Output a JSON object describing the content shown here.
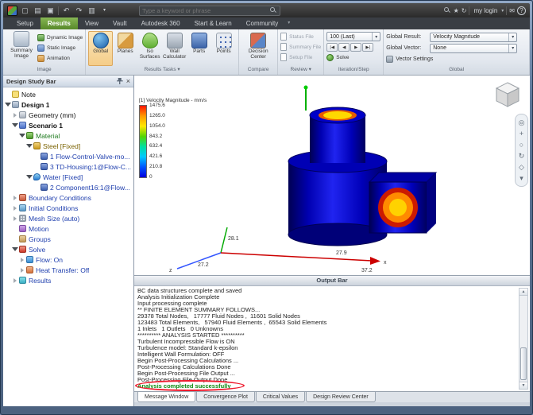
{
  "titlebar": {
    "search_placeholder": "Type a keyword or phrase",
    "login_label": "my login"
  },
  "ribbon_tabs": {
    "items": [
      "Setup",
      "Results",
      "View",
      "Vault",
      "Autodesk 360",
      "Start & Learn",
      "Community"
    ],
    "active": "Results"
  },
  "ribbon": {
    "image": {
      "label": "Image",
      "summary": "Summary Image",
      "dynamic": "Dynamic Image",
      "static": "Static Image",
      "animation": "Animation"
    },
    "results_tasks": {
      "label": "Results Tasks ▾",
      "global": "Global",
      "planes": "Planes",
      "iso": "Iso Surfaces",
      "wall": "Wall Calculator",
      "parts": "Parts",
      "points": "Points",
      "selected": "Global"
    },
    "compare": {
      "label": "Compare",
      "decision": "Decision Center"
    },
    "review": {
      "label": "Review ▾",
      "status": "Status File",
      "summary": "Summary File",
      "setup": "Setup File"
    },
    "iteration": {
      "label": "Iteration/Step",
      "combo": "100 (Last)",
      "play": [
        "|◀",
        "◀",
        "▶",
        "▶|"
      ],
      "solve": "Solve"
    },
    "global_group": {
      "label": "Global",
      "result_label": "Global Result:",
      "result_value": "Velocity Magnitude",
      "vector_label": "Global Vector:",
      "vector_value": "None",
      "vector_settings": "Vector Settings"
    }
  },
  "design_study_bar": {
    "title": "Design Study Bar",
    "tree": [
      {
        "label": "Note"
      },
      {
        "label": "Design 1"
      },
      {
        "label": "Geometry (mm)"
      },
      {
        "label": "Scenario 1"
      },
      {
        "label": "Material"
      },
      {
        "label": "Steel [Fixed]"
      },
      {
        "label": "1 Flow-Control-Valve-mo..."
      },
      {
        "label": "3 TD-Housing:1@Flow-C..."
      },
      {
        "label": "Water [Fixed]"
      },
      {
        "label": "2 Component16:1@Flow..."
      },
      {
        "label": "Boundary Conditions"
      },
      {
        "label": "Initial Conditions"
      },
      {
        "label": "Mesh Size (auto)"
      },
      {
        "label": "Motion"
      },
      {
        "label": "Groups"
      },
      {
        "label": "Solve"
      },
      {
        "label": "Flow: On"
      },
      {
        "label": "Heat Transfer: Off"
      },
      {
        "label": "Results"
      }
    ]
  },
  "viewport": {
    "legend": {
      "title": "[1] Velocity Magnitude - mm/s",
      "values": [
        "1475.6",
        "1265.0",
        "1054.0",
        "843.2",
        "632.4",
        "421.6",
        "210.8",
        "0"
      ],
      "colors": [
        "#ff1400",
        "#ff9900",
        "#ffe800",
        "#55d400",
        "#00e0a0",
        "#00c8ff",
        "#0055ff",
        "#0000dc"
      ]
    },
    "triad": {
      "n1": "28.1",
      "n2": "27.2",
      "n3": "27.9",
      "n4": "37.2",
      "x": "x",
      "z": "z"
    }
  },
  "output_bar": {
    "title": "Output Bar",
    "lines": [
      "BC data structures complete and saved",
      "Analysis Initialization Complete",
      "Input processing complete",
      "** FINITE ELEMENT SUMMARY FOLLOWS...",
      "29378 Total Nodes,   17777 Fluid Nodes ,  11601 Solid Nodes",
      "123483 Total Elements,   57940 Fluid Elements ,  65543 Solid Elements",
      "1 Inlets   1 Outlets   0 Unknowns",
      "********** ANALYSIS STARTED **********",
      "Turbulent Incompressible Flow is ON",
      "Turbulence model: Standard k-epsilon",
      "Intelligent Wall Formulation: OFF",
      "Begin Post-Processing Calculations ...",
      "Post-Processing Calculations Done",
      "Begin Post-Processing File Output ...",
      "Post-Processing File Output Done",
      "Analysis completed successfully"
    ],
    "highlight_color": "#0c8a10"
  },
  "bottom_tabs": {
    "items": [
      "Message Window",
      "Convergence Plot",
      "Critical Values",
      "Design Review Center"
    ],
    "active": "Message Window"
  }
}
